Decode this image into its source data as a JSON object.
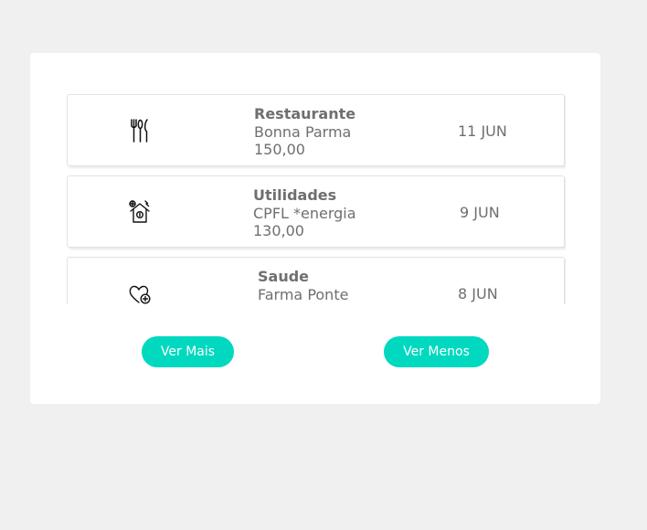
{
  "transactions": [
    {
      "category": "Restaurante",
      "merchant": "Bonna Parma",
      "amount": "150,00",
      "date": "11 JUN",
      "icon": "utensils-icon"
    },
    {
      "category": "Utilidades",
      "merchant": "CPFL *energia",
      "amount": "130,00",
      "date": "9 JUN",
      "icon": "house-utilities-icon"
    },
    {
      "category": "Saude",
      "merchant": "Farma Ponte",
      "amount": "",
      "date": "8 JUN",
      "icon": "heart-health-icon"
    }
  ],
  "buttons": {
    "more_label": "Ver Mais",
    "less_label": "Ver Menos"
  },
  "colors": {
    "accent": "#00d9bf",
    "text": "#6f6f6f",
    "background": "#f0f0f0"
  }
}
